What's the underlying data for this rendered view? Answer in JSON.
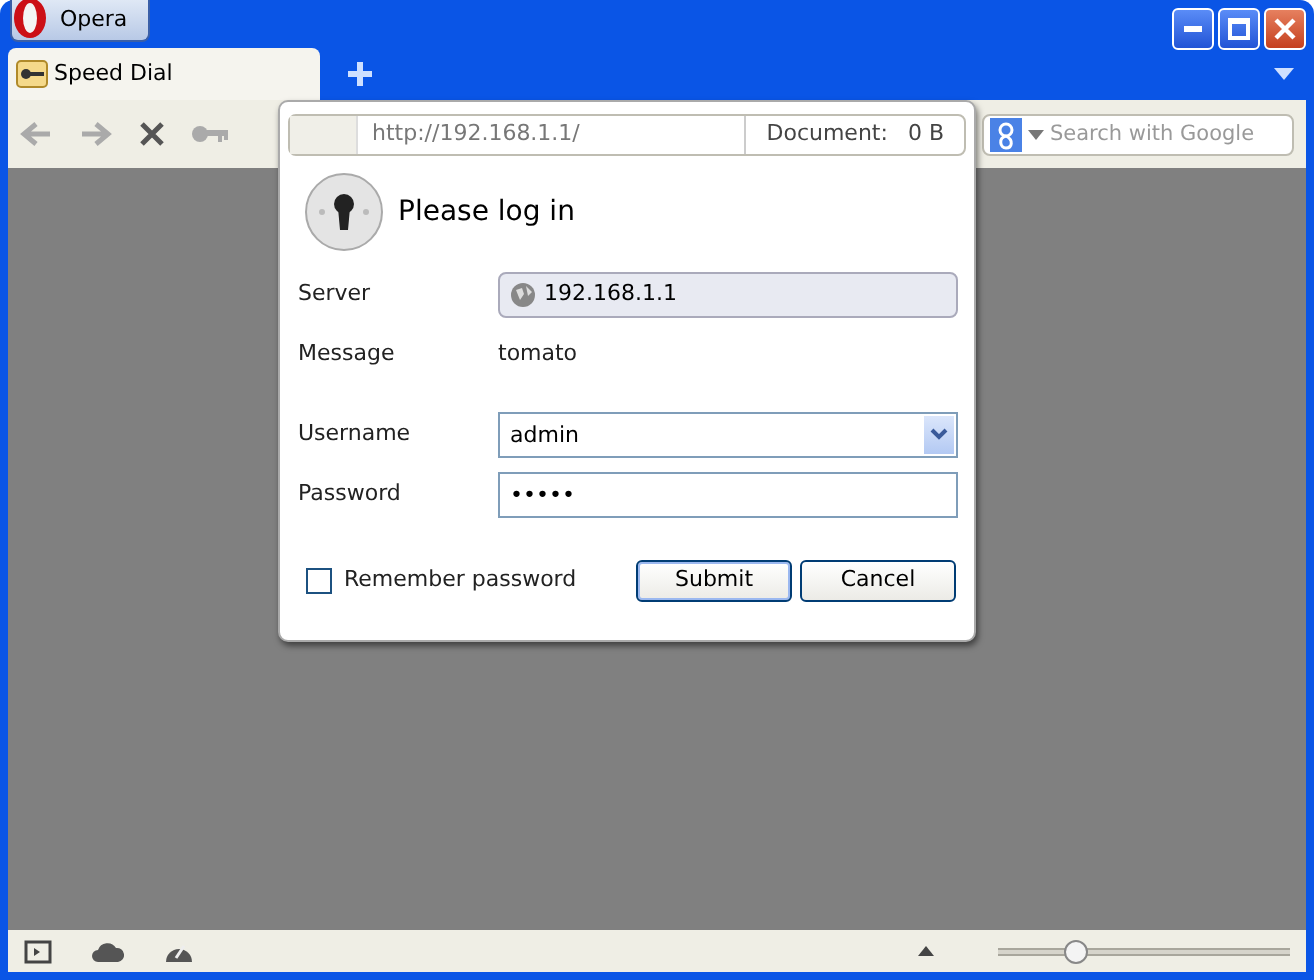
{
  "menu_button": {
    "label": "Opera"
  },
  "tabs": [
    {
      "label": "Speed Dial",
      "selected": true
    }
  ],
  "address_bar": {
    "url": "http://192.168.1.1/",
    "document_label": "Document:",
    "document_size": "0 B"
  },
  "search": {
    "placeholder": "Search with Google"
  },
  "login_dialog": {
    "title": "Please log in",
    "rows": [
      {
        "kind": "server",
        "label": "Server",
        "value": "192.168.1.1"
      },
      {
        "kind": "message",
        "label": "Message",
        "value": "tomato"
      },
      {
        "kind": "combo",
        "label": "Username",
        "value": "admin"
      },
      {
        "kind": "password",
        "label": "Password",
        "value": "•••••"
      }
    ],
    "remember": {
      "label": "Remember password",
      "checked": false
    },
    "buttons": [
      {
        "label": "Submit",
        "default": true
      },
      {
        "label": "Cancel",
        "default": false
      }
    ]
  },
  "status_bar": {
    "zoom": {
      "level": 0.27
    }
  }
}
